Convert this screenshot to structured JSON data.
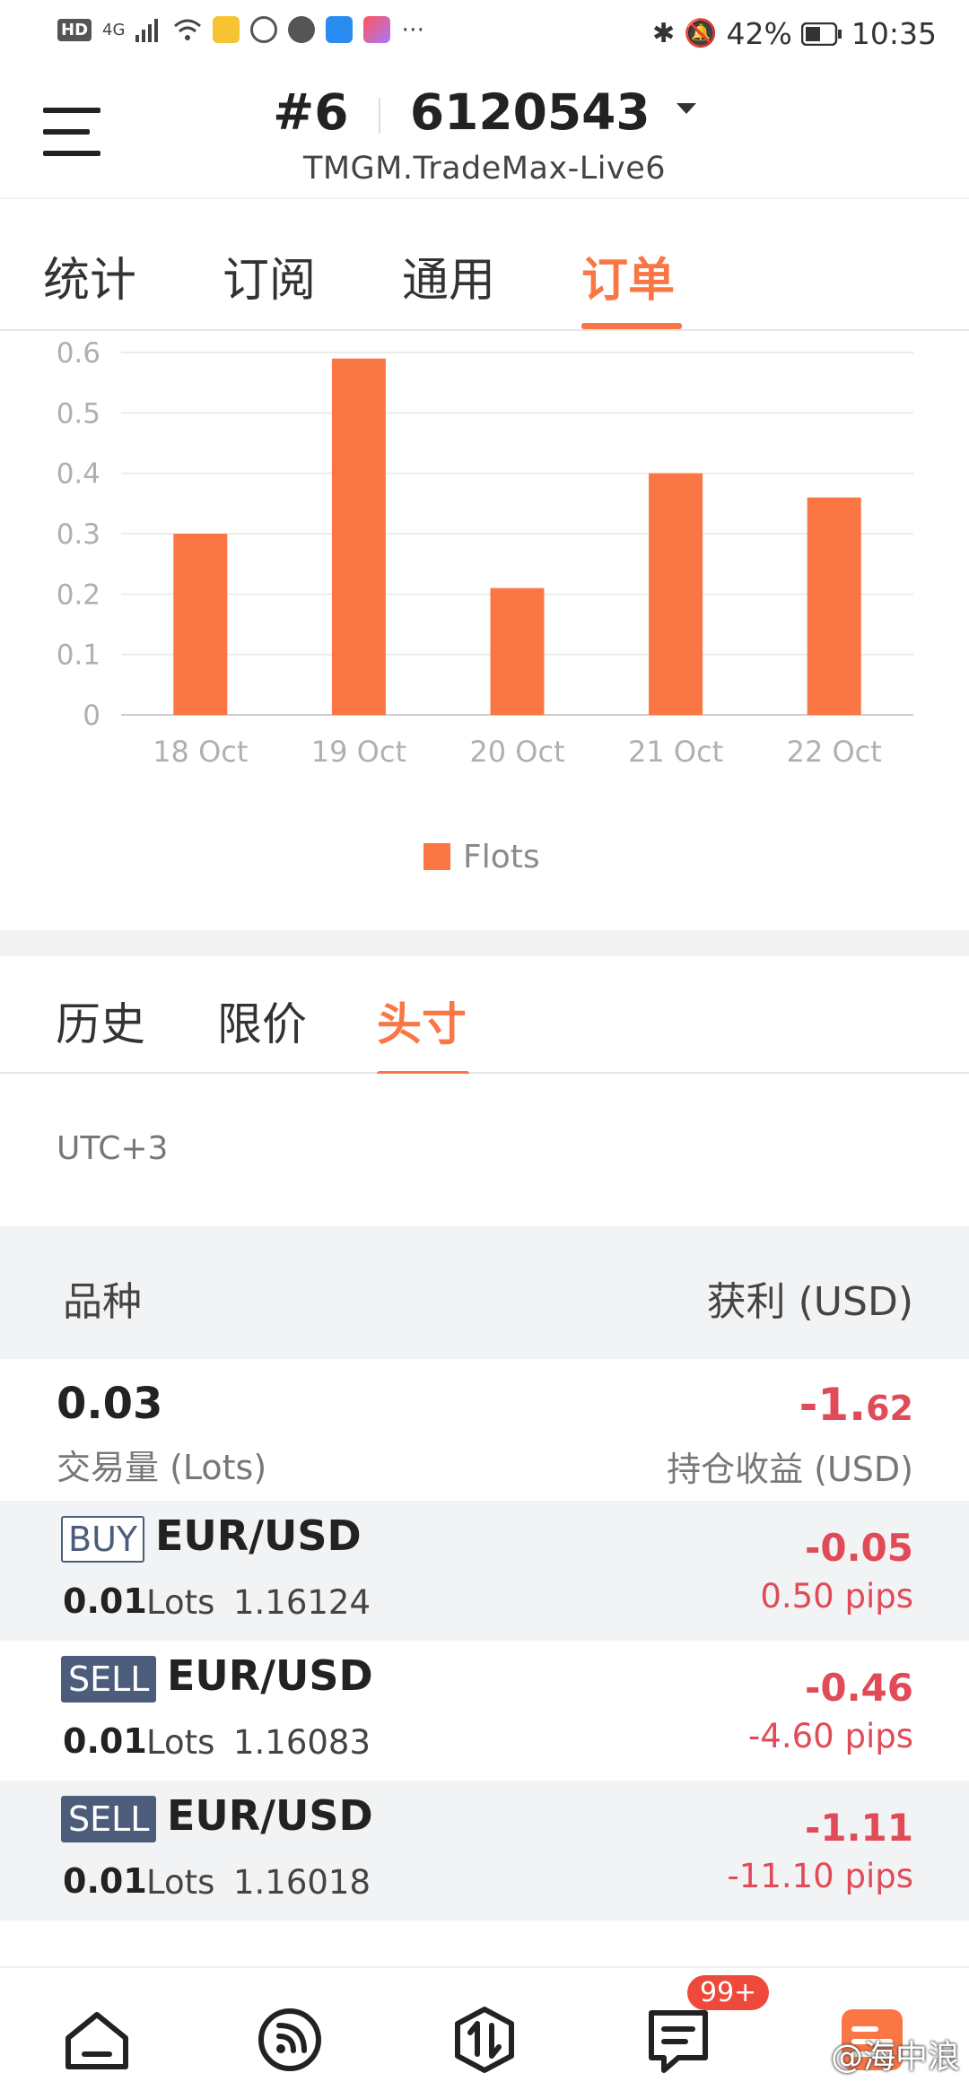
{
  "status_bar": {
    "battery": "42%",
    "time": "10:35",
    "network": "4G"
  },
  "header": {
    "account_prefix": "#6",
    "account_number": "6120543",
    "server": "TMGM.TradeMax-Live6"
  },
  "top_tabs": [
    {
      "label": "统计",
      "active": false
    },
    {
      "label": "订阅",
      "active": false
    },
    {
      "label": "通用",
      "active": false
    },
    {
      "label": "订单",
      "active": true
    }
  ],
  "chart_data": {
    "type": "bar",
    "categories": [
      "18 Oct",
      "19 Oct",
      "20 Oct",
      "21 Oct",
      "22 Oct"
    ],
    "series": [
      {
        "name": "Flots",
        "values": [
          0.3,
          0.59,
          0.21,
          0.4,
          0.36
        ]
      }
    ],
    "yticks": [
      "0",
      "0.1",
      "0.2",
      "0.3",
      "0.4",
      "0.5",
      "0.6"
    ],
    "ylim": [
      0,
      0.6
    ],
    "grid": true,
    "legend": "bottom",
    "color": "#fb7645"
  },
  "sub_tabs": [
    {
      "label": "历史",
      "active": false
    },
    {
      "label": "限价",
      "active": false
    },
    {
      "label": "头寸",
      "active": true
    }
  ],
  "timezone": "UTC+3",
  "table_header": {
    "left": "品种",
    "right": "获利 (USD)"
  },
  "summary": {
    "volume": "0.03",
    "volume_label": "交易量 (Lots)",
    "pnl_int": "-1.",
    "pnl_dec": "62",
    "pnl_label": "持仓收益 (USD)"
  },
  "positions": [
    {
      "side": "BUY",
      "symbol": "EUR/USD",
      "volume": "0.01",
      "lots_label": "Lots",
      "price": "1.16124",
      "profit": "-0.05",
      "pips": "0.50 pips"
    },
    {
      "side": "SELL",
      "symbol": "EUR/USD",
      "volume": "0.01",
      "lots_label": "Lots",
      "price": "1.16083",
      "profit": "-0.46",
      "pips": "-4.60 pips"
    },
    {
      "side": "SELL",
      "symbol": "EUR/USD",
      "volume": "0.01",
      "lots_label": "Lots",
      "price": "1.16018",
      "profit": "-1.11",
      "pips": "-11.10 pips"
    }
  ],
  "bottom_nav": {
    "badge": "99+",
    "icons": [
      "home-icon",
      "feed-icon",
      "trade-icon",
      "messages-icon",
      "orders-icon"
    ]
  },
  "watermark": "@海中浪"
}
